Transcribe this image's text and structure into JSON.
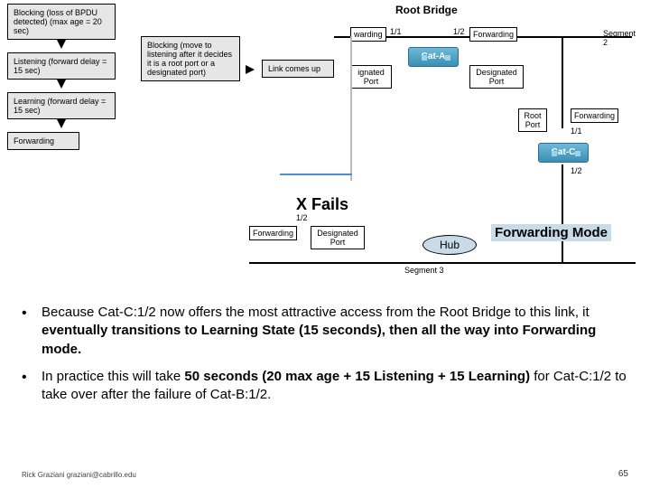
{
  "states": {
    "blocking": "Blocking\n(loss of BPDU detected)\n(max age = 20 sec)",
    "listening": "Listening\n(forward delay = 15 sec)",
    "learning": "Learning\n(forward delay = 15 sec)",
    "forwarding": "Forwarding",
    "blocking_move": "Blocking\n(move to listening after it decides it is a root port or a designated port)",
    "link_comes_up": "Link comes up"
  },
  "topology": {
    "root_bridge": "Root Bridge",
    "cat_a": "Cat-A",
    "cat_c": "Cat-C",
    "ports": {
      "a_left": "1/1",
      "a_right": "1/2",
      "a_left_state": "warding",
      "a_right_state": "Forwarding",
      "c_top": "1/1",
      "c_bottom": "1/2",
      "c_top_role": "Root Port",
      "c_top_state": "Forwarding",
      "b_bottom": "1/2",
      "b_role": "Designated Port",
      "b_state": "Forwarding",
      "a_left_role": "ignated Port",
      "a_right_role": "Designated Port"
    },
    "segments": {
      "seg2": "Segment 2",
      "seg3": "Segment 3"
    },
    "hub": "Hub",
    "xfail": "X Fails",
    "fwd_mode": "Forwarding Mode"
  },
  "bullets": [
    "Because Cat-C:1/2 now offers the most attractive access from the Root Bridge to this link, it eventually transitions to Learning State (15 seconds), then all the way into Forwarding mode.",
    "In practice this will take 50 seconds (20 max age + 15 Listening + 15 Learning) for Cat-C:1/2 to take over after the failure of Cat-B:1/2."
  ],
  "footer": {
    "left": "Rick Graziani  graziani@cabrillo.edu",
    "right": "65"
  }
}
